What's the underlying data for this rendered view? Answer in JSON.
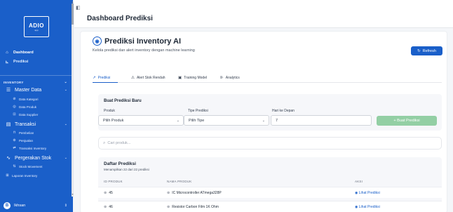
{
  "sidebar": {
    "logo_main": "ADIO",
    "logo_sub": "app",
    "items": [
      {
        "label": "Dashboard",
        "icon": "home-icon"
      },
      {
        "label": "Prediksi",
        "icon": "chart-icon"
      }
    ],
    "section_label": "INVENTORY",
    "groups": [
      {
        "label": "Master Data",
        "icon": "database-icon",
        "children": [
          "Data Kategori",
          "Data Produk",
          "Data Supplier"
        ]
      },
      {
        "label": "Transaksi",
        "icon": "transaction-icon",
        "children": [
          "Pembelian",
          "Penjualan",
          "Transaksi Inventory"
        ]
      },
      {
        "label": "Pergerakan Stok",
        "icon": "pulse-icon",
        "children": [
          "Stock Movement"
        ]
      },
      {
        "label": "Laporan Inventory",
        "icon": "report-icon",
        "children": []
      }
    ],
    "user": {
      "initial": "B",
      "name": "Ikhsan"
    }
  },
  "header": {
    "title": "Dashboard Prediksi"
  },
  "main": {
    "title": "Prediksi Inventory AI",
    "subtitle": "Kelola prediksi dan alert inventory dengan machine learning",
    "refresh_label": "Refresh",
    "tabs": [
      {
        "label": "Prediksi",
        "active": true
      },
      {
        "label": "Alert Stok Rendah",
        "active": false
      },
      {
        "label": "Training Model",
        "active": false
      },
      {
        "label": "Analytics",
        "active": false
      }
    ],
    "form": {
      "title": "Buat Prediksi Baru",
      "product_label": "Produk",
      "product_value": "Pilih Produk",
      "type_label": "Tipe Prediksi",
      "type_value": "Pilih Tipe",
      "days_label": "Hari ke Depan",
      "days_value": "7",
      "submit_label": "+ Buat Prediksi"
    },
    "search_placeholder": "Cari produk...",
    "list": {
      "title": "Daftar Prediksi",
      "subtitle": "Menampilkan 22 dari 22 prediksi",
      "columns": [
        "ID PRODUK",
        "NAMA PRODUK",
        "AKSI"
      ],
      "rows": [
        {
          "id": "45",
          "name": "IC Microcontroller ATmega328P",
          "action": "Lihat Prediksi"
        },
        {
          "id": "46",
          "name": "Resistor Carbon Film 1K Ohm",
          "action": "Lihat Prediksi"
        }
      ]
    }
  },
  "colors": {
    "brand": "#1a5fc9",
    "success": "#93cfa4"
  }
}
